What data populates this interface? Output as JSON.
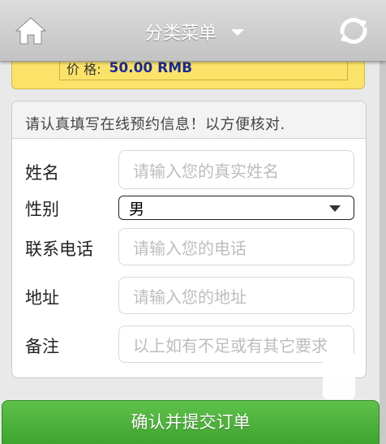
{
  "header": {
    "title": "分类菜单",
    "home_icon": "home-icon",
    "refresh_icon": "refresh-icon"
  },
  "price": {
    "label": "价 格:",
    "value": "50.00 RMB"
  },
  "form": {
    "notice": "请认真填写在线预约信息！以方便核对.",
    "name": {
      "label": "姓名",
      "placeholder": "请输入您的真实姓名"
    },
    "gender": {
      "label": "性别",
      "selected": "男"
    },
    "phone": {
      "label": "联系电话",
      "placeholder": "请输入您的电话"
    },
    "address": {
      "label": "地址",
      "placeholder": "请输入您的地址"
    },
    "remark": {
      "label": "备注",
      "placeholder": "以上如有不足或有其它要求"
    }
  },
  "submit_label": "确认并提交订单",
  "colors": {
    "header": "#c9c9c9",
    "price_bg": "#fbe36a",
    "price_text": "#1a2a9a",
    "submit": "#46ad36"
  }
}
